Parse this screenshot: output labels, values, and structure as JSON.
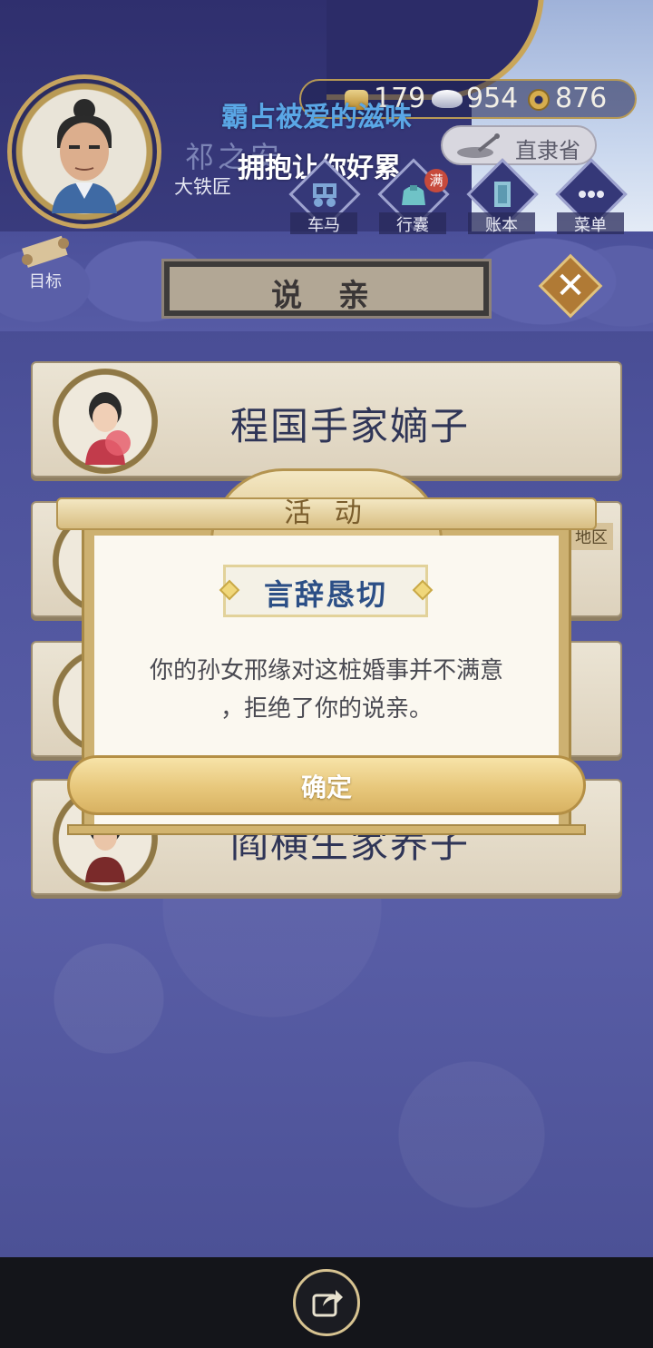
{
  "player": {
    "name": "祁之安",
    "title": "大铁匠"
  },
  "overlay_text": {
    "line1": "霸占被爱的滋味",
    "line2": "拥抱让你好累"
  },
  "currency": {
    "gold": "179",
    "silver": "954",
    "copper": "876"
  },
  "location": {
    "province": "直隶省"
  },
  "menu": {
    "items": [
      {
        "label": "车马",
        "icon": "carriage-icon"
      },
      {
        "label": "行囊",
        "icon": "bag-icon",
        "badge": "满"
      },
      {
        "label": "账本",
        "icon": "ledger-icon"
      },
      {
        "label": "菜单",
        "icon": "more-icon"
      }
    ],
    "goal_label": "目标"
  },
  "screen": {
    "title": "说 亲"
  },
  "list": {
    "items": [
      {
        "name": "程国手家嫡子",
        "tag": ""
      },
      {
        "name": "",
        "tag": "地区"
      },
      {
        "name": "",
        "tag": ""
      },
      {
        "name": "阎横生家养子",
        "tag": ""
      }
    ]
  },
  "modal": {
    "header": "活 动",
    "subtitle": "言辞恳切",
    "message_line1": "你的孙女邢缘对这桩婚事并不满意",
    "message_line2": "，拒绝了你的说亲。",
    "confirm_label": "确定"
  },
  "colors": {
    "accent_gold": "#cdb171",
    "title_blue": "#2c4f86",
    "overlay_blue": "#5aa7e6",
    "background_indigo": "#4a4f93"
  }
}
